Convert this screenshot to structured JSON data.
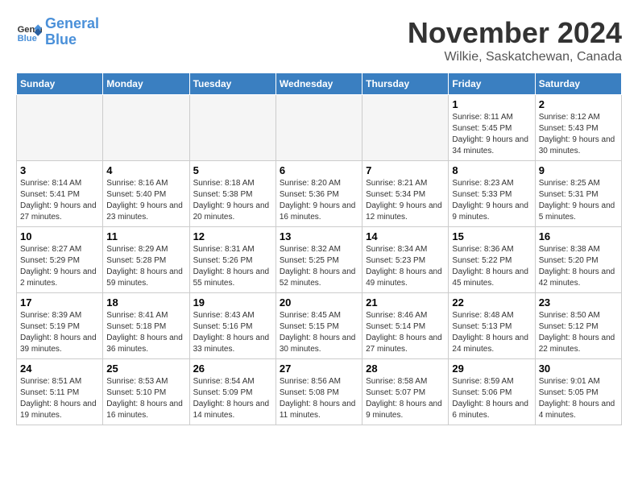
{
  "header": {
    "logo_line1": "General",
    "logo_line2": "Blue",
    "month_title": "November 2024",
    "location": "Wilkie, Saskatchewan, Canada"
  },
  "weekdays": [
    "Sunday",
    "Monday",
    "Tuesday",
    "Wednesday",
    "Thursday",
    "Friday",
    "Saturday"
  ],
  "weeks": [
    [
      {
        "day": "",
        "info": ""
      },
      {
        "day": "",
        "info": ""
      },
      {
        "day": "",
        "info": ""
      },
      {
        "day": "",
        "info": ""
      },
      {
        "day": "",
        "info": ""
      },
      {
        "day": "1",
        "info": "Sunrise: 8:11 AM\nSunset: 5:45 PM\nDaylight: 9 hours and 34 minutes."
      },
      {
        "day": "2",
        "info": "Sunrise: 8:12 AM\nSunset: 5:43 PM\nDaylight: 9 hours and 30 minutes."
      }
    ],
    [
      {
        "day": "3",
        "info": "Sunrise: 8:14 AM\nSunset: 5:41 PM\nDaylight: 9 hours and 27 minutes."
      },
      {
        "day": "4",
        "info": "Sunrise: 8:16 AM\nSunset: 5:40 PM\nDaylight: 9 hours and 23 minutes."
      },
      {
        "day": "5",
        "info": "Sunrise: 8:18 AM\nSunset: 5:38 PM\nDaylight: 9 hours and 20 minutes."
      },
      {
        "day": "6",
        "info": "Sunrise: 8:20 AM\nSunset: 5:36 PM\nDaylight: 9 hours and 16 minutes."
      },
      {
        "day": "7",
        "info": "Sunrise: 8:21 AM\nSunset: 5:34 PM\nDaylight: 9 hours and 12 minutes."
      },
      {
        "day": "8",
        "info": "Sunrise: 8:23 AM\nSunset: 5:33 PM\nDaylight: 9 hours and 9 minutes."
      },
      {
        "day": "9",
        "info": "Sunrise: 8:25 AM\nSunset: 5:31 PM\nDaylight: 9 hours and 5 minutes."
      }
    ],
    [
      {
        "day": "10",
        "info": "Sunrise: 8:27 AM\nSunset: 5:29 PM\nDaylight: 9 hours and 2 minutes."
      },
      {
        "day": "11",
        "info": "Sunrise: 8:29 AM\nSunset: 5:28 PM\nDaylight: 8 hours and 59 minutes."
      },
      {
        "day": "12",
        "info": "Sunrise: 8:31 AM\nSunset: 5:26 PM\nDaylight: 8 hours and 55 minutes."
      },
      {
        "day": "13",
        "info": "Sunrise: 8:32 AM\nSunset: 5:25 PM\nDaylight: 8 hours and 52 minutes."
      },
      {
        "day": "14",
        "info": "Sunrise: 8:34 AM\nSunset: 5:23 PM\nDaylight: 8 hours and 49 minutes."
      },
      {
        "day": "15",
        "info": "Sunrise: 8:36 AM\nSunset: 5:22 PM\nDaylight: 8 hours and 45 minutes."
      },
      {
        "day": "16",
        "info": "Sunrise: 8:38 AM\nSunset: 5:20 PM\nDaylight: 8 hours and 42 minutes."
      }
    ],
    [
      {
        "day": "17",
        "info": "Sunrise: 8:39 AM\nSunset: 5:19 PM\nDaylight: 8 hours and 39 minutes."
      },
      {
        "day": "18",
        "info": "Sunrise: 8:41 AM\nSunset: 5:18 PM\nDaylight: 8 hours and 36 minutes."
      },
      {
        "day": "19",
        "info": "Sunrise: 8:43 AM\nSunset: 5:16 PM\nDaylight: 8 hours and 33 minutes."
      },
      {
        "day": "20",
        "info": "Sunrise: 8:45 AM\nSunset: 5:15 PM\nDaylight: 8 hours and 30 minutes."
      },
      {
        "day": "21",
        "info": "Sunrise: 8:46 AM\nSunset: 5:14 PM\nDaylight: 8 hours and 27 minutes."
      },
      {
        "day": "22",
        "info": "Sunrise: 8:48 AM\nSunset: 5:13 PM\nDaylight: 8 hours and 24 minutes."
      },
      {
        "day": "23",
        "info": "Sunrise: 8:50 AM\nSunset: 5:12 PM\nDaylight: 8 hours and 22 minutes."
      }
    ],
    [
      {
        "day": "24",
        "info": "Sunrise: 8:51 AM\nSunset: 5:11 PM\nDaylight: 8 hours and 19 minutes."
      },
      {
        "day": "25",
        "info": "Sunrise: 8:53 AM\nSunset: 5:10 PM\nDaylight: 8 hours and 16 minutes."
      },
      {
        "day": "26",
        "info": "Sunrise: 8:54 AM\nSunset: 5:09 PM\nDaylight: 8 hours and 14 minutes."
      },
      {
        "day": "27",
        "info": "Sunrise: 8:56 AM\nSunset: 5:08 PM\nDaylight: 8 hours and 11 minutes."
      },
      {
        "day": "28",
        "info": "Sunrise: 8:58 AM\nSunset: 5:07 PM\nDaylight: 8 hours and 9 minutes."
      },
      {
        "day": "29",
        "info": "Sunrise: 8:59 AM\nSunset: 5:06 PM\nDaylight: 8 hours and 6 minutes."
      },
      {
        "day": "30",
        "info": "Sunrise: 9:01 AM\nSunset: 5:05 PM\nDaylight: 8 hours and 4 minutes."
      }
    ]
  ]
}
